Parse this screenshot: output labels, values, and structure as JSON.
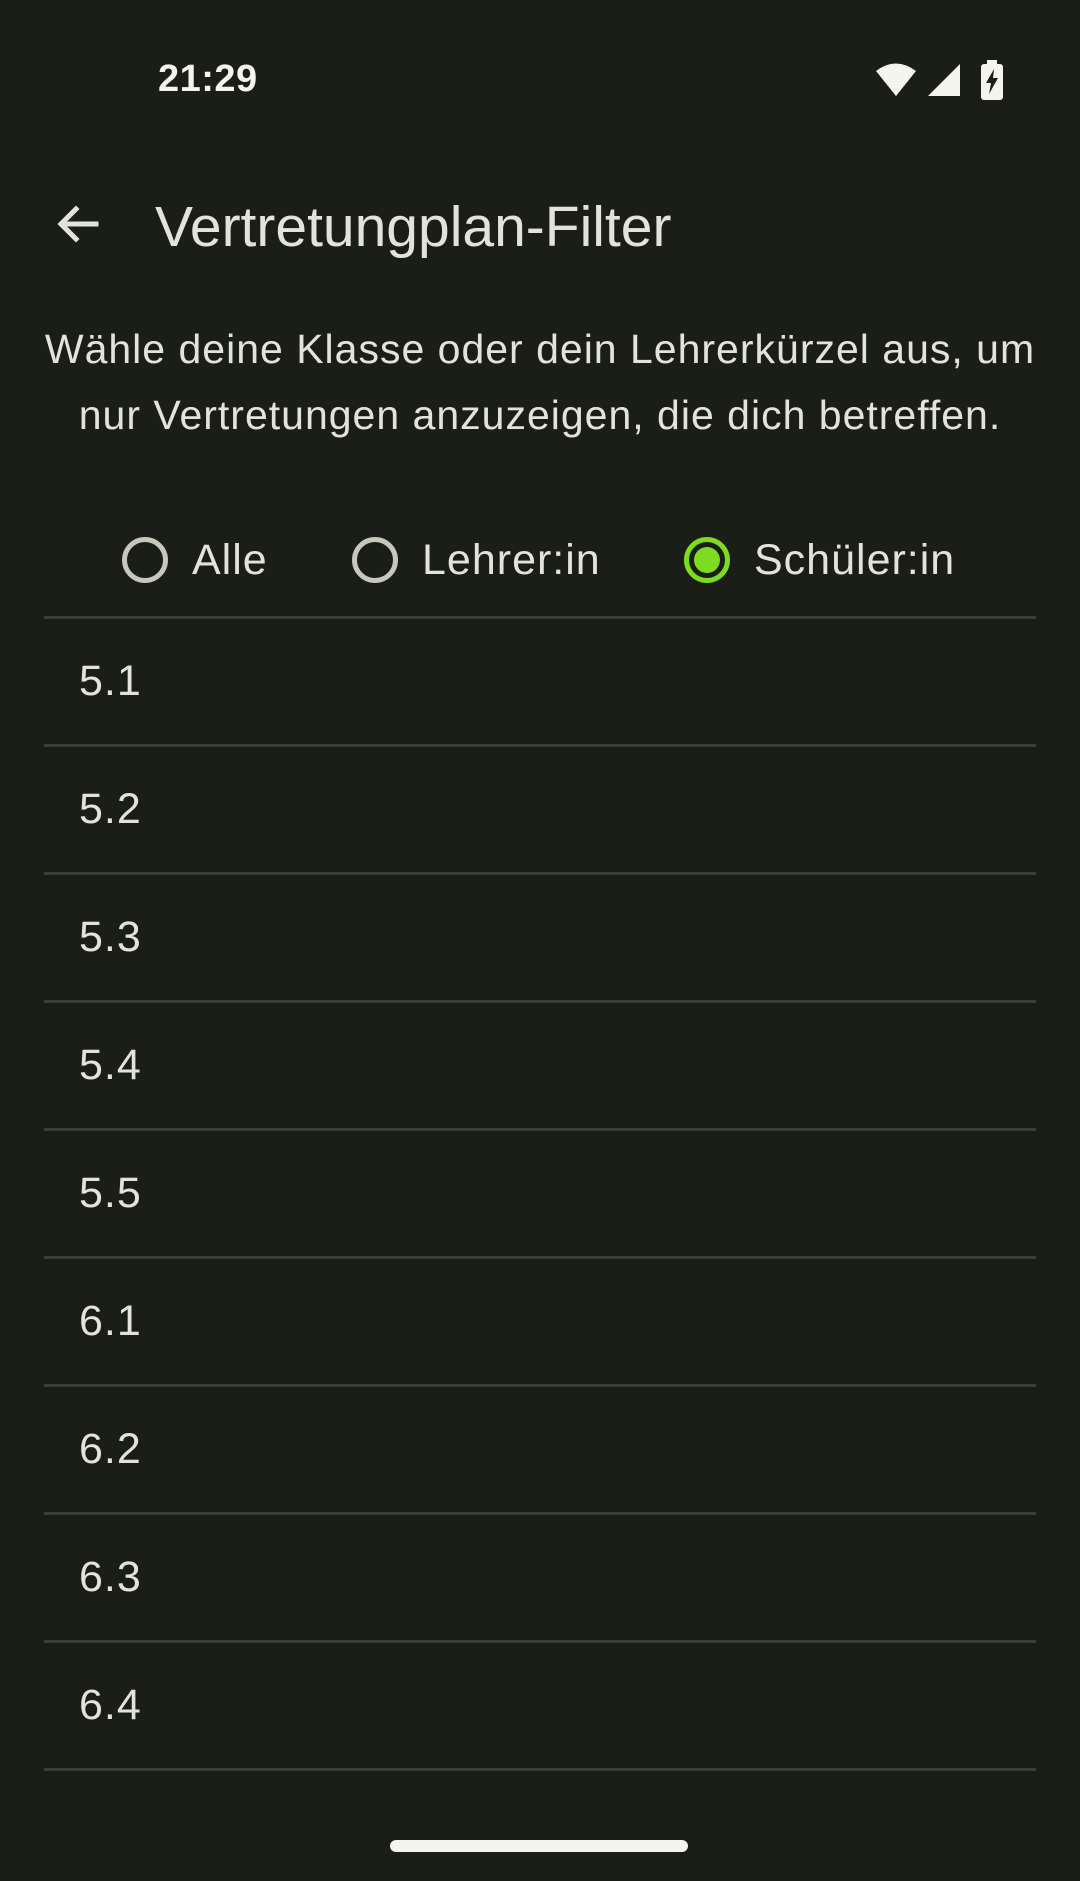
{
  "status_bar": {
    "time": "21:29",
    "icons": [
      "wifi-icon",
      "signal-icon",
      "battery-charging-icon"
    ]
  },
  "app_bar": {
    "back_icon": "arrow-back-icon",
    "title": "Vertretungplan-Filter"
  },
  "description": "Wähle deine Klasse oder dein Lehrerkürzel aus, um nur Vertretungen anzuzeigen, die dich betreffen.",
  "filter_options": [
    {
      "label": "Alle",
      "selected": false
    },
    {
      "label": "Lehrer:in",
      "selected": false
    },
    {
      "label": "Schüler:in",
      "selected": true
    }
  ],
  "colors": {
    "background": "#1a1e16",
    "accent": "#7ddc1f",
    "text": "#e3e4d9",
    "divider": "#3a4036"
  },
  "classes": [
    "5.1",
    "5.2",
    "5.3",
    "5.4",
    "5.5",
    "6.1",
    "6.2",
    "6.3",
    "6.4"
  ]
}
